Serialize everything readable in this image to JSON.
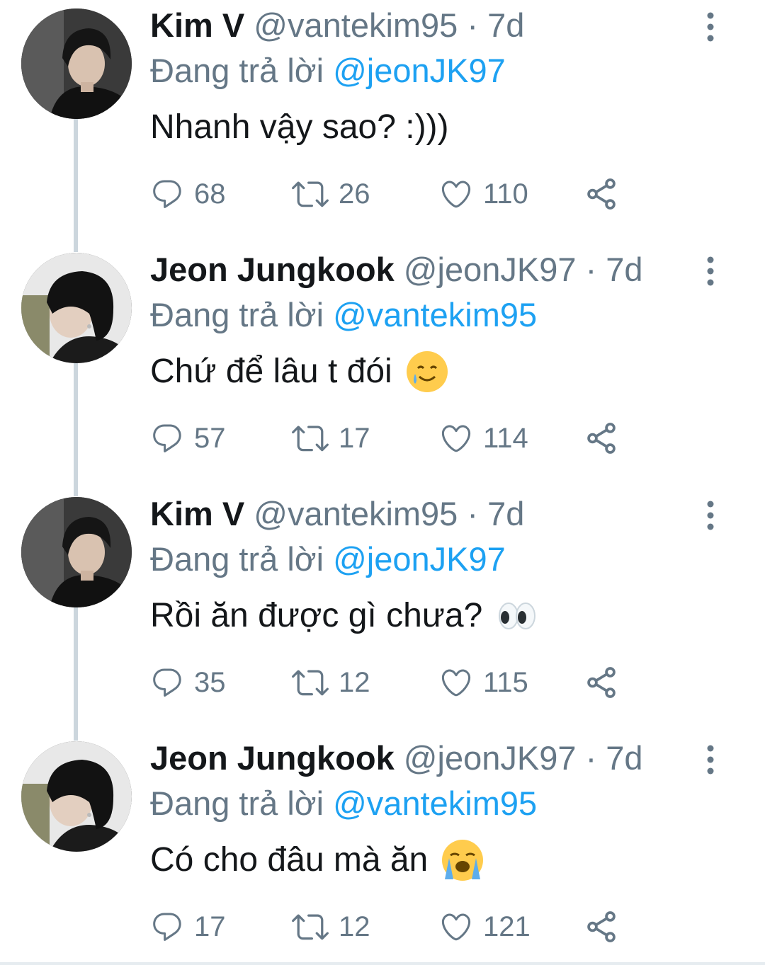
{
  "tweets": [
    {
      "name": "Kim V",
      "handle": "@vantekim95",
      "separator": "·",
      "time": "7d",
      "replying_prefix": "Đang trả lời",
      "replying_to": "@jeonJK97",
      "text": "Nhanh vậy sao? :)))",
      "emoji": "",
      "avatar": "kimv",
      "replies": "68",
      "retweets": "26",
      "likes": "110"
    },
    {
      "name": "Jeon Jungkook",
      "handle": "@jeonJK97",
      "separator": "·",
      "time": "7d",
      "replying_prefix": "Đang trả lời",
      "replying_to": "@vantekim95",
      "text": "Chứ để lâu t đói",
      "emoji": "smiling-face-with-tear",
      "avatar": "jungkook",
      "replies": "57",
      "retweets": "17",
      "likes": "114"
    },
    {
      "name": "Kim V",
      "handle": "@vantekim95",
      "separator": "·",
      "time": "7d",
      "replying_prefix": "Đang trả lời",
      "replying_to": "@jeonJK97",
      "text": "Rồi ăn được gì chưa?",
      "emoji": "eyes",
      "avatar": "kimv",
      "replies": "35",
      "retweets": "12",
      "likes": "115"
    },
    {
      "name": "Jeon Jungkook",
      "handle": "@jeonJK97",
      "separator": "·",
      "time": "7d",
      "replying_prefix": "Đang trả lời",
      "replying_to": "@vantekim95",
      "text": "Có cho đâu mà ăn",
      "emoji": "loudly-crying-face",
      "avatar": "jungkook",
      "replies": "17",
      "retweets": "12",
      "likes": "121"
    }
  ],
  "colors": {
    "name": "#14171a",
    "secondary": "#657786",
    "mention": "#1da1f2",
    "thread_line": "#ccd6dd"
  },
  "icons": {
    "reply": "reply-icon",
    "retweet": "retweet-icon",
    "like": "heart-icon",
    "share": "share-icon",
    "more": "more-vertical-icon"
  }
}
